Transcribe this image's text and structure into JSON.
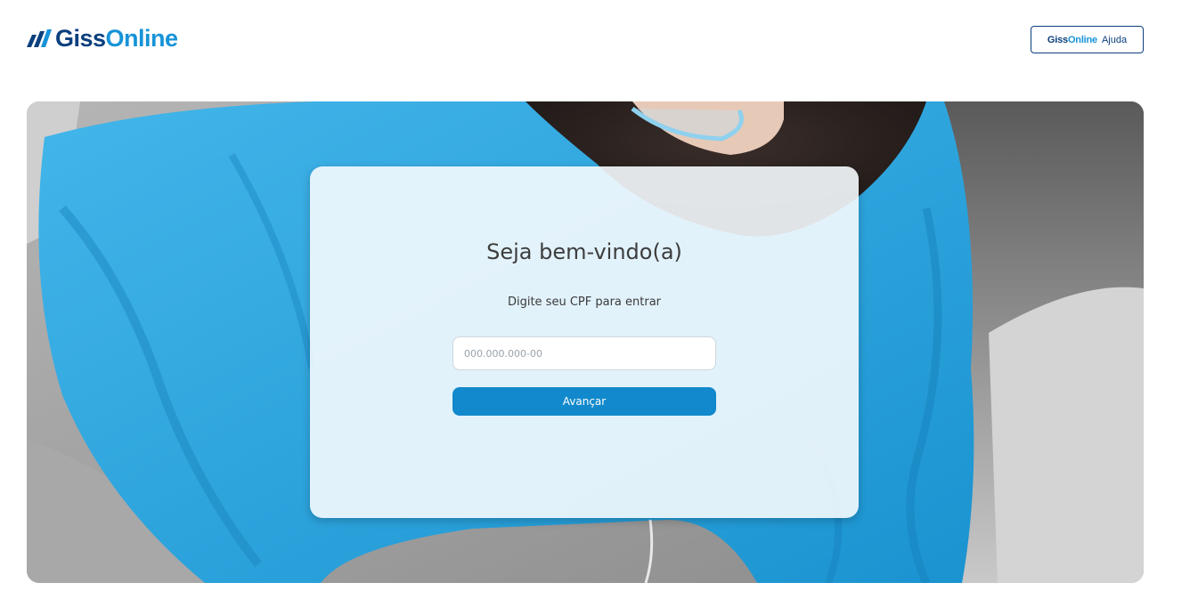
{
  "header": {
    "logo": {
      "part1": "Giss",
      "part2": "Online",
      "icon": "bars-logo-icon"
    },
    "help_button": {
      "part1": "Giss",
      "part2": "Online",
      "part3": "Ajuda"
    }
  },
  "login": {
    "title": "Seja bem-vindo(a)",
    "subtitle": "Digite seu CPF para entrar",
    "cpf_placeholder": "000.000.000-00",
    "cpf_value": "",
    "submit_label": "Avançar"
  },
  "colors": {
    "brand_dark": "#0b3f7e",
    "brand_light": "#1793d8",
    "button": "#1289cc",
    "hoodie": "#29a6df"
  }
}
